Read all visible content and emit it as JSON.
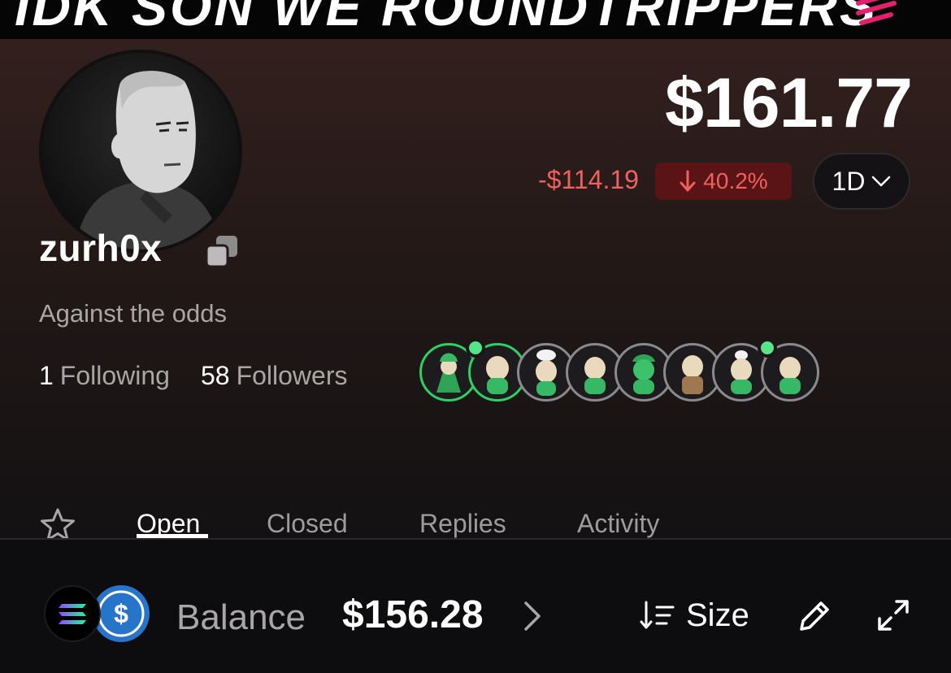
{
  "banner": {
    "text": "IDK SON WE ROUNDTRIPPERS",
    "emoji_icon": "hundred-points-icon"
  },
  "profile": {
    "username": "zurh0x",
    "bio": "Against the odds",
    "following_count": "1",
    "following_label": "Following",
    "followers_count": "58",
    "followers_label": "Followers",
    "avatar_icon": "wojak-avatar"
  },
  "portfolio": {
    "total_value": "$161.77",
    "change_amount": "-$114.19",
    "change_percent": "40.2%",
    "change_direction_icon": "arrow-down-icon",
    "period": "1D"
  },
  "badges": {
    "count": 8,
    "online_dots": [
      0,
      7
    ]
  },
  "tabs": [
    {
      "label": "Open",
      "active": true
    },
    {
      "label": "Closed",
      "active": false
    },
    {
      "label": "Replies",
      "active": false
    },
    {
      "label": "Activity",
      "active": false
    }
  ],
  "footer": {
    "balance_label": "Balance",
    "balance_value": "$156.28",
    "sort_label": "Size"
  },
  "colors": {
    "negative": "#f0605e",
    "negative_bg": "#5a1416",
    "badge_active": "#2ecf63",
    "online_dot": "#56e38a",
    "usdc_blue": "#2775ca"
  }
}
